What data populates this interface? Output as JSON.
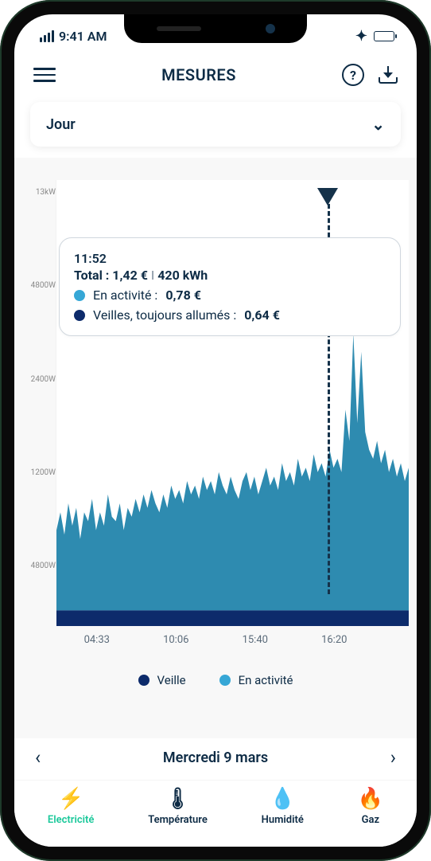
{
  "statusbar": {
    "time": "9:41 AM"
  },
  "header": {
    "title": "MESURES"
  },
  "dropdown": {
    "label": "Jour"
  },
  "tooltip": {
    "time": "11:52",
    "total_label": "Total :",
    "total_cost": "1,42 €",
    "total_kwh": "420 kWh",
    "active_label": "En activité :",
    "active_cost": "0,78 €",
    "standby_label": "Veilles, toujours allumés :",
    "standby_cost": "0,64 €"
  },
  "legend": {
    "standby": "Veille",
    "active": "En activité"
  },
  "date": {
    "label": "Mercredi 9 mars"
  },
  "tabs": {
    "electricity": "Electricité",
    "temperature": "Température",
    "humidity": "Humidité",
    "gas": "Gaz"
  },
  "chart_data": {
    "type": "area",
    "title": "",
    "xlabel": "",
    "ylabel": "",
    "y_ticks": [
      "13kW",
      "4800W",
      "2400W",
      "1200W",
      "4800W"
    ],
    "x_ticks": [
      "04:33",
      "10:06",
      "15:40",
      "16:20"
    ],
    "marker_x_fraction": 0.77,
    "series": [
      {
        "name": "En activité",
        "color": "#2e8bb0",
        "values_fraction": [
          0.18,
          0.22,
          0.17,
          0.24,
          0.19,
          0.23,
          0.16,
          0.22,
          0.2,
          0.25,
          0.18,
          0.22,
          0.19,
          0.26,
          0.21,
          0.2,
          0.24,
          0.18,
          0.23,
          0.21,
          0.25,
          0.22,
          0.26,
          0.23,
          0.27,
          0.24,
          0.22,
          0.26,
          0.23,
          0.28,
          0.25,
          0.27,
          0.24,
          0.29,
          0.26,
          0.28,
          0.25,
          0.3,
          0.27,
          0.29,
          0.26,
          0.31,
          0.28,
          0.26,
          0.3,
          0.27,
          0.25,
          0.29,
          0.31,
          0.27,
          0.3,
          0.26,
          0.29,
          0.32,
          0.28,
          0.3,
          0.27,
          0.33,
          0.29,
          0.31,
          0.28,
          0.34,
          0.3,
          0.32,
          0.29,
          0.35,
          0.31,
          0.33,
          0.3,
          0.36,
          0.32,
          0.34,
          0.31,
          0.45,
          0.38,
          0.62,
          0.42,
          0.58,
          0.4,
          0.36,
          0.34,
          0.38,
          0.33,
          0.36,
          0.31,
          0.34,
          0.3,
          0.33,
          0.29,
          0.32
        ]
      },
      {
        "name": "Veille",
        "color": "#0d2b6b",
        "constant_fraction": 0.035
      }
    ]
  }
}
